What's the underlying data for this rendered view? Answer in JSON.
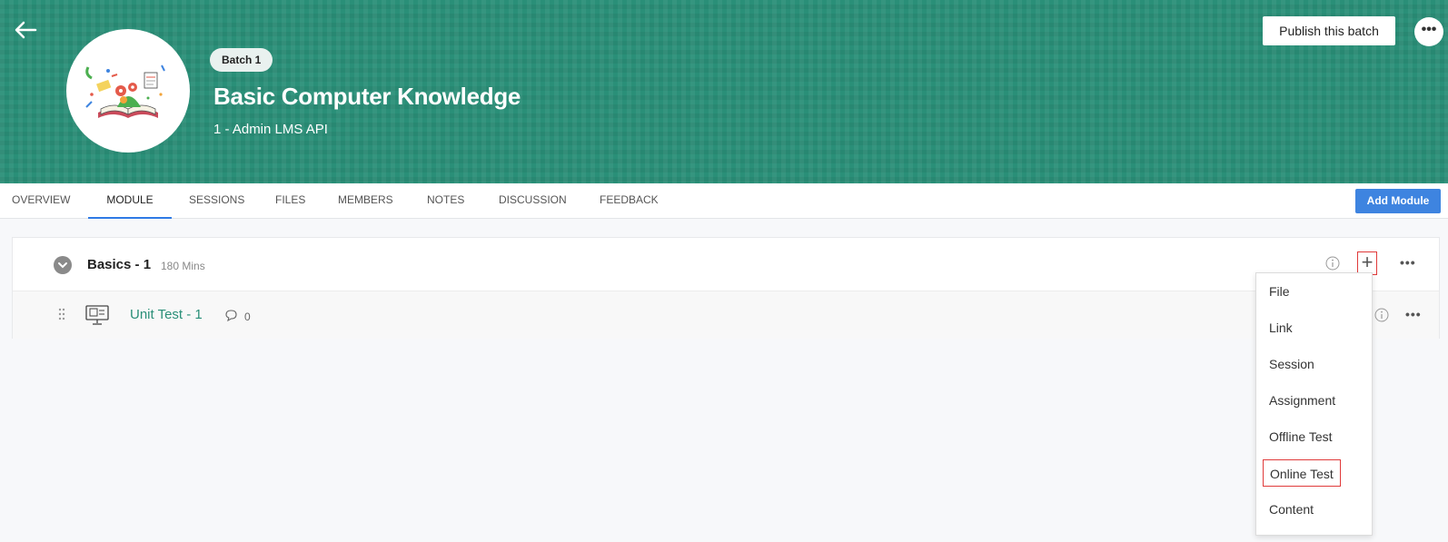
{
  "header": {
    "batch_label": "Batch 1",
    "course_title": "Basic Computer Knowledge",
    "subtitle": "1 - Admin LMS API",
    "publish_label": "Publish this batch",
    "more_label": "•••",
    "banner_color": "#2a8f78"
  },
  "tabs": [
    {
      "label": "OVERVIEW"
    },
    {
      "label": "MODULE"
    },
    {
      "label": "SESSIONS"
    },
    {
      "label": "FILES"
    },
    {
      "label": "MEMBERS"
    },
    {
      "label": "NOTES"
    },
    {
      "label": "DISCUSSION"
    },
    {
      "label": "FEEDBACK"
    }
  ],
  "active_tab": "MODULE",
  "add_module_label": "Add Module",
  "module": {
    "name": "Basics - 1",
    "duration": "180 Mins",
    "more_label": "•••",
    "unit": {
      "name": "Unit Test - 1",
      "comments": "0",
      "more_label": "•••"
    }
  },
  "add_menu": {
    "items": [
      {
        "label": "File"
      },
      {
        "label": "Link"
      },
      {
        "label": "Session"
      },
      {
        "label": "Assignment"
      },
      {
        "label": "Offline Test"
      },
      {
        "label": "Online Test"
      },
      {
        "label": "Content"
      }
    ],
    "highlighted": "Online Test"
  },
  "colors": {
    "accent_blue": "#3e84e0",
    "highlight_red": "#e03a3a",
    "unit_green": "#2a8f78"
  }
}
